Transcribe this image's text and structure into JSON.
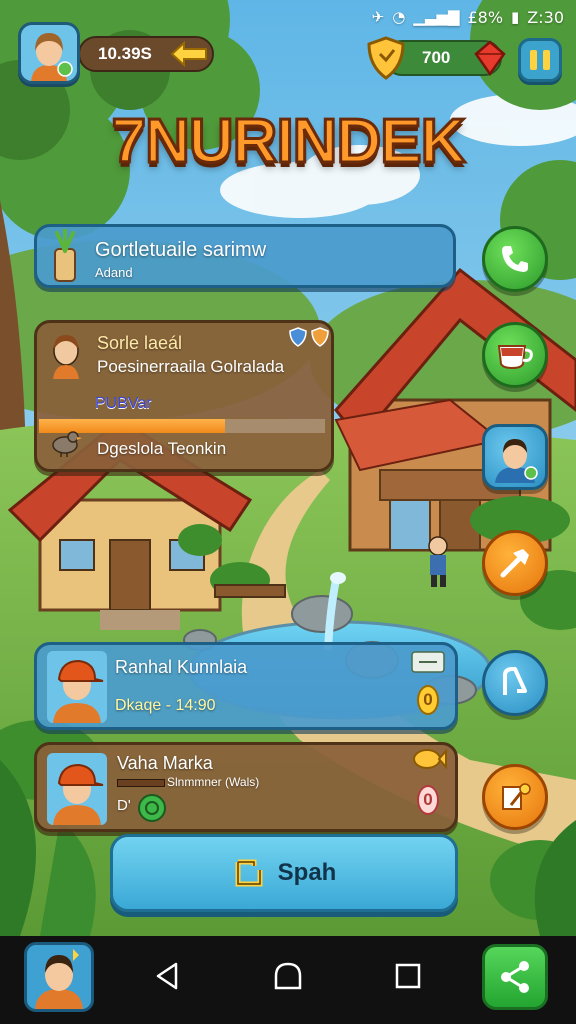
{
  "status_bar": {
    "battery_pct": "£8%",
    "time": "Z:30"
  },
  "hud": {
    "coins": "10.39S",
    "gems": "700",
    "title": "7NURINDEK"
  },
  "quest_card": {
    "title": "Gortletuaile sarimw",
    "subtitle": "Adand"
  },
  "character_card": {
    "name": "Sorle laeál",
    "line": "Poesinerraaila Golralada",
    "tag": "PUBVar",
    "progress": 0.65,
    "footer": "Dgeslola Teonkin"
  },
  "player_card_1": {
    "name": "Ranhal Kunnlaia",
    "detail": "Dkaqe - 14:90",
    "badge": "0"
  },
  "player_card_2": {
    "name": "Vaha Marka",
    "detail": "Slnmmner (Wals)",
    "prefix": "D'",
    "badge": "0"
  },
  "main_button": {
    "label": "Spah"
  },
  "icons": {
    "right_buttons": [
      "phone-icon",
      "tea-cup-icon",
      "villager-portrait-icon",
      "hammer-icon",
      "horseshoe-icon",
      "quill-icon"
    ],
    "nav": [
      "back-icon",
      "home-icon",
      "recents-icon",
      "share-icon"
    ]
  }
}
